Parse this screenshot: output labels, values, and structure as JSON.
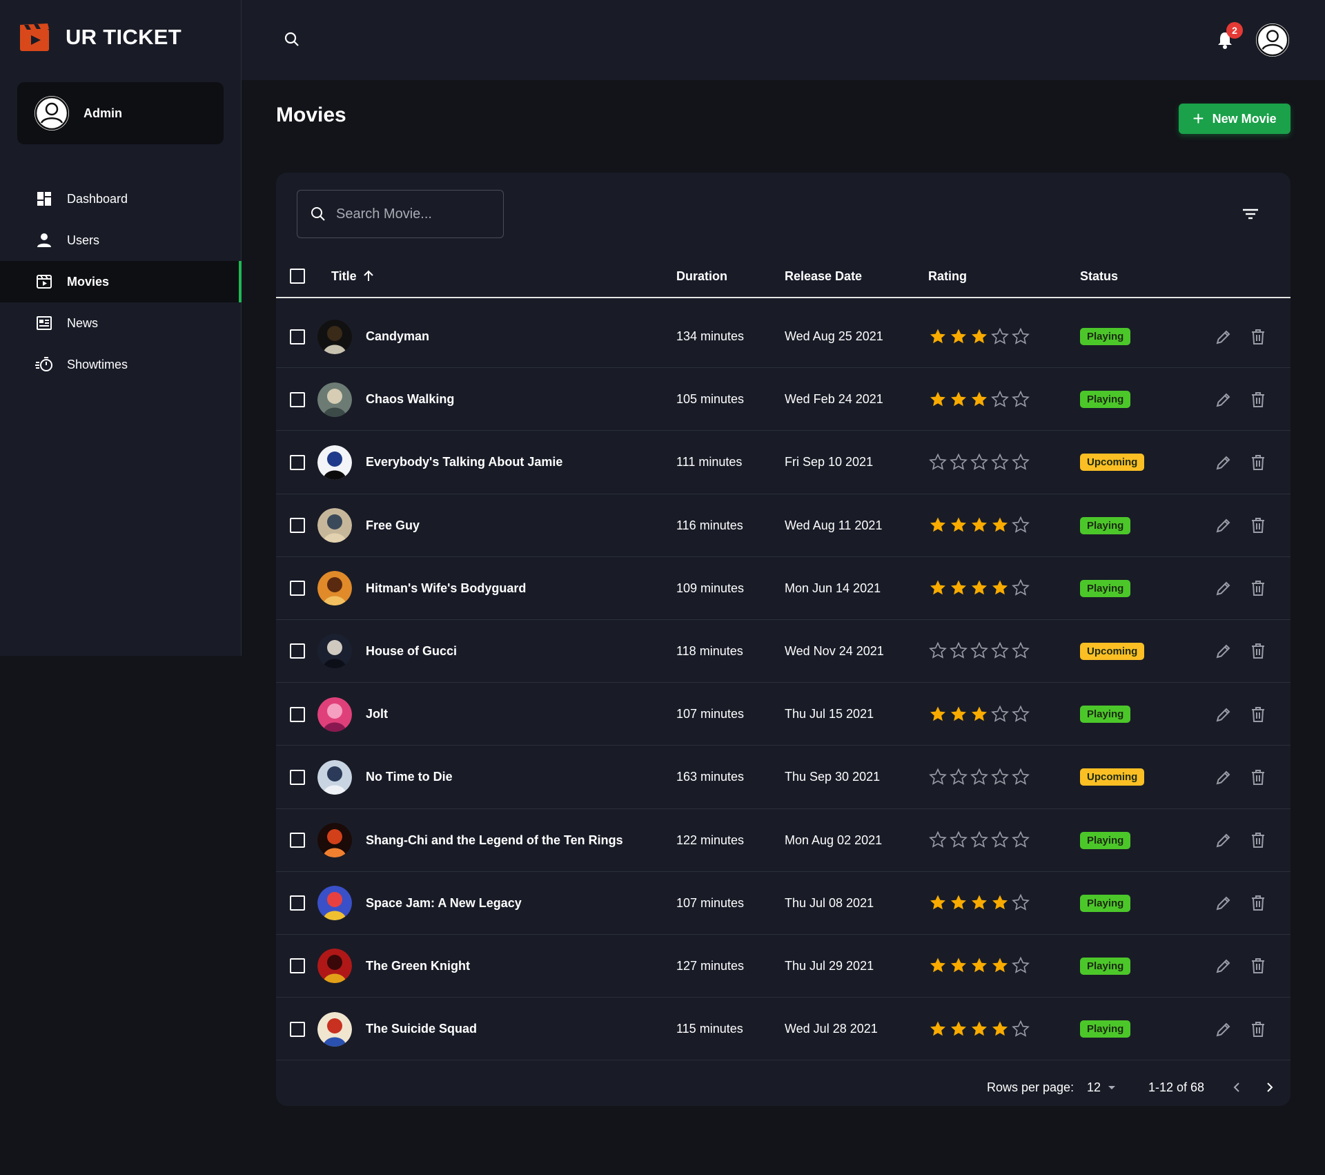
{
  "app": {
    "brand": "UR TICKET"
  },
  "user": {
    "name": "Admin"
  },
  "sidebar": {
    "items": [
      {
        "label": "Dashboard",
        "icon": "dashboard-icon",
        "active": false
      },
      {
        "label": "Users",
        "icon": "person-icon",
        "active": false
      },
      {
        "label": "Movies",
        "icon": "movie-icon",
        "active": true
      },
      {
        "label": "News",
        "icon": "news-icon",
        "active": false
      },
      {
        "label": "Showtimes",
        "icon": "timer-icon",
        "active": false
      }
    ]
  },
  "topbar": {
    "notification_count": "2"
  },
  "page": {
    "title": "Movies",
    "new_button": "New Movie"
  },
  "search": {
    "placeholder": "Search Movie..."
  },
  "table": {
    "columns": {
      "title": "Title",
      "duration": "Duration",
      "release_date": "Release Date",
      "rating": "Rating",
      "status": "Status"
    },
    "sort": {
      "column": "Title",
      "direction": "ascending"
    },
    "rows": [
      {
        "title": "Candyman",
        "duration": "134 minutes",
        "release_date": "Wed Aug 25 2021",
        "rating": 3,
        "status": "Playing",
        "poster": [
          "#111111",
          "#3a2a18",
          "#c8c2b0"
        ]
      },
      {
        "title": "Chaos Walking",
        "duration": "105 minutes",
        "release_date": "Wed Feb 24 2021",
        "rating": 3,
        "status": "Playing",
        "poster": [
          "#6c7c74",
          "#d6cdb4",
          "#3c4a48"
        ]
      },
      {
        "title": "Everybody's Talking About Jamie",
        "duration": "111 minutes",
        "release_date": "Fri Sep 10 2021",
        "rating": 0,
        "status": "Upcoming",
        "poster": [
          "#f2f4f8",
          "#1f3a8a",
          "#0b0b0b"
        ]
      },
      {
        "title": "Free Guy",
        "duration": "116 minutes",
        "release_date": "Wed Aug 11 2021",
        "rating": 4,
        "status": "Playing",
        "poster": [
          "#c7b79a",
          "#3b4a5a",
          "#e3d2b0"
        ]
      },
      {
        "title": "Hitman's Wife's Bodyguard",
        "duration": "109 minutes",
        "release_date": "Mon Jun 14 2021",
        "rating": 4,
        "status": "Playing",
        "poster": [
          "#e08a2a",
          "#5a2a10",
          "#f2c060"
        ]
      },
      {
        "title": "House of Gucci",
        "duration": "118 minutes",
        "release_date": "Wed Nov 24 2021",
        "rating": 0,
        "status": "Upcoming",
        "poster": [
          "#1a2030",
          "#cfc9c0",
          "#0c0f18"
        ]
      },
      {
        "title": "Jolt",
        "duration": "107 minutes",
        "release_date": "Thu Jul 15 2021",
        "rating": 3,
        "status": "Playing",
        "poster": [
          "#e0407a",
          "#f5a0c0",
          "#8a1850"
        ]
      },
      {
        "title": "No Time to Die",
        "duration": "163 minutes",
        "release_date": "Thu Sep 30 2021",
        "rating": 0,
        "status": "Upcoming",
        "poster": [
          "#c8d4e2",
          "#2a3a58",
          "#eef2f6"
        ]
      },
      {
        "title": "Shang-Chi and the Legend of the Ten Rings",
        "duration": "122 minutes",
        "release_date": "Mon Aug 02 2021",
        "rating": 0,
        "status": "Playing",
        "poster": [
          "#1a0a08",
          "#d2401a",
          "#f08030"
        ]
      },
      {
        "title": "Space Jam: A New Legacy",
        "duration": "107 minutes",
        "release_date": "Thu Jul 08 2021",
        "rating": 4,
        "status": "Playing",
        "poster": [
          "#3a50c8",
          "#e84040",
          "#f0c030"
        ]
      },
      {
        "title": "The Green Knight",
        "duration": "127 minutes",
        "release_date": "Thu Jul 29 2021",
        "rating": 4,
        "status": "Playing",
        "poster": [
          "#b01818",
          "#3a0808",
          "#e2a018"
        ]
      },
      {
        "title": "The Suicide Squad",
        "duration": "115 minutes",
        "release_date": "Wed Jul 28 2021",
        "rating": 4,
        "status": "Playing",
        "poster": [
          "#f0e6d0",
          "#c83020",
          "#2a50b0"
        ]
      }
    ]
  },
  "pagination": {
    "rows_per_page_label": "Rows per page:",
    "rows_per_page": "12",
    "range": "1-12 of 68"
  },
  "colors": {
    "accent": "#1aa14a",
    "active_indicator": "#1db954",
    "brand_logo": "#d9481a",
    "playing": "#4cc72a",
    "upcoming": "#fbbf24",
    "star": "#f9ab00",
    "star_empty": "#9a9da6"
  }
}
